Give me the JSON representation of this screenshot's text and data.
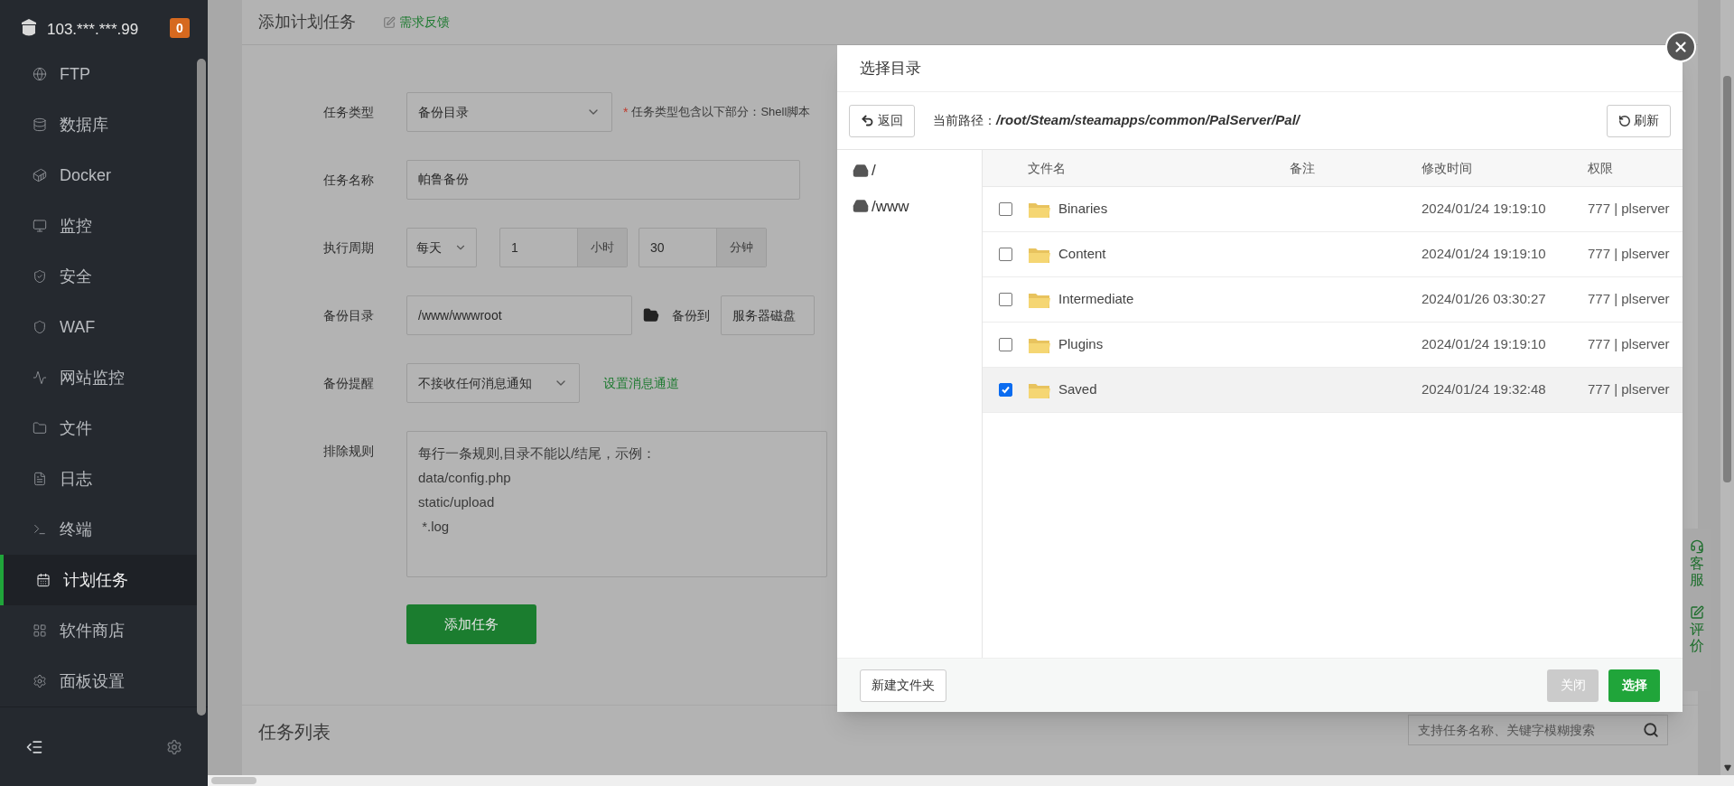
{
  "sidebar": {
    "server": "103.***.***.99",
    "badge": "0",
    "items": [
      {
        "label": "FTP",
        "selected": false
      },
      {
        "label": "数据库",
        "selected": false
      },
      {
        "label": "Docker",
        "selected": false
      },
      {
        "label": "监控",
        "selected": false
      },
      {
        "label": "安全",
        "selected": false
      },
      {
        "label": "WAF",
        "selected": false
      },
      {
        "label": "网站监控",
        "selected": false
      },
      {
        "label": "文件",
        "selected": false
      },
      {
        "label": "日志",
        "selected": false
      },
      {
        "label": "终端",
        "selected": false
      },
      {
        "label": "计划任务",
        "selected": true
      },
      {
        "label": "软件商店",
        "selected": false
      },
      {
        "label": "面板设置",
        "selected": false
      }
    ]
  },
  "form": {
    "title": "添加计划任务",
    "feedback": "需求反馈",
    "task_type": {
      "label": "任务类型",
      "value": "备份目录",
      "required_mark": "*",
      "hint": "任务类型包含以下部分：Shell脚本"
    },
    "task_name": {
      "label": "任务名称",
      "value": "帕鲁备份"
    },
    "period": {
      "label": "执行周期",
      "value": "每天",
      "hour": "1",
      "hour_unit": "小时",
      "minute": "30",
      "minute_unit": "分钟"
    },
    "backup_dir": {
      "label": "备份目录",
      "value": "/www/wwwroot",
      "target_label": "备份到",
      "target": "服务器磁盘"
    },
    "notify": {
      "label": "备份提醒",
      "value": "不接收任何消息通知",
      "link": "设置消息通道"
    },
    "exclude": {
      "label": "排除规则",
      "placeholder": "每行一条规则,目录不能以/结尾，示例：\ndata/config.php\nstatic/upload\n *.log"
    },
    "submit": "添加任务"
  },
  "task_list": {
    "title": "任务列表",
    "search": {
      "placeholder": "支持任务名称、关键字模糊搜索"
    }
  },
  "dialog": {
    "title": "选择目录",
    "back": "返回",
    "path_label": "当前路径：",
    "path": "/root/Steam/steamapps/common/PalServer/Pal/",
    "refresh": "刷新",
    "drives": [
      "/",
      "/www"
    ],
    "columns": [
      "文件名",
      "备注",
      "修改时间",
      "权限"
    ],
    "rows": [
      {
        "name": "Binaries",
        "modified": "2024/01/24 19:19:10",
        "permission": "777 | plserver",
        "checked": false,
        "selected": false
      },
      {
        "name": "Content",
        "modified": "2024/01/24 19:19:10",
        "permission": "777 | plserver",
        "checked": false,
        "selected": false
      },
      {
        "name": "Intermediate",
        "modified": "2024/01/26 03:30:27",
        "permission": "777 | plserver",
        "checked": false,
        "selected": false
      },
      {
        "name": "Plugins",
        "modified": "2024/01/24 19:19:10",
        "permission": "777 | plserver",
        "checked": false,
        "selected": false
      },
      {
        "name": "Saved",
        "modified": "2024/01/24 19:32:48",
        "permission": "777 | plserver",
        "checked": true,
        "selected": true
      }
    ],
    "new_folder": "新建文件夹",
    "close": "关闭",
    "choose": "选择"
  },
  "side_tabs": [
    {
      "label": "客服"
    },
    {
      "label": "评价"
    }
  ]
}
